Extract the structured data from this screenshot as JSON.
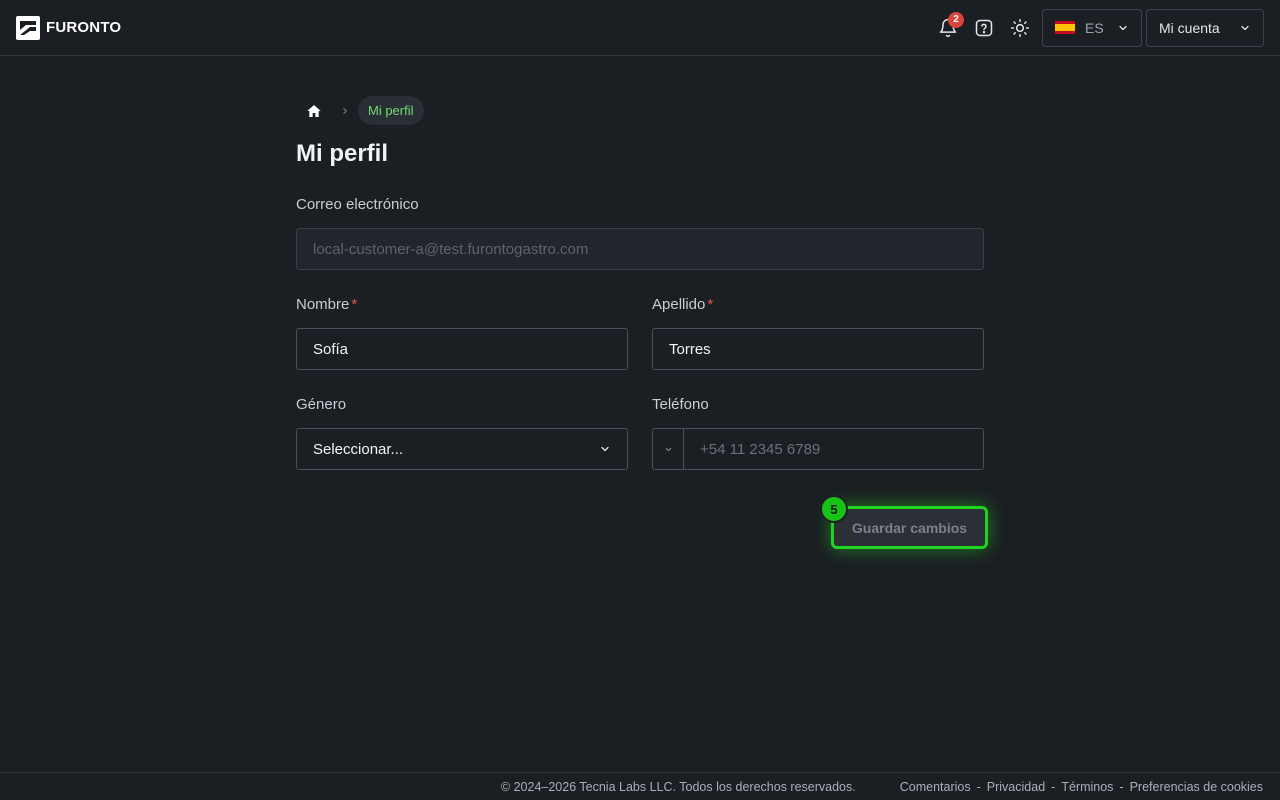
{
  "header": {
    "logo_text": "FURONTO",
    "notifications_count": "2",
    "language": {
      "code": "ES",
      "flag": "spain-flag-icon"
    },
    "account_label": "Mi cuenta"
  },
  "breadcrumb": {
    "current": "Mi perfil"
  },
  "page": {
    "title": "Mi perfil"
  },
  "form": {
    "email": {
      "label": "Correo electrónico",
      "value": "local-customer-a@test.furontogastro.com"
    },
    "first_name": {
      "label": "Nombre",
      "required_mark": "*",
      "value": "Sofía"
    },
    "last_name": {
      "label": "Apellido",
      "required_mark": "*",
      "value": "Torres"
    },
    "gender": {
      "label": "Género",
      "selected": "Seleccionar..."
    },
    "phone": {
      "label": "Teléfono",
      "placeholder": "+54 11 2345 6789"
    },
    "save_label": "Guardar cambios",
    "step_badge": "5"
  },
  "footer": {
    "copyright": "© 2024–2026 Tecnia Labs LLC. Todos los derechos reservados.",
    "links": [
      "Comentarios",
      "Privacidad",
      "Términos",
      "Preferencias de cookies"
    ],
    "separator": "-"
  },
  "colors": {
    "background": "#1b1e23",
    "accent": "#21d321",
    "breadcrumb_active": "#6fdc6f",
    "badge": "#d9453d",
    "required": "#e05a55"
  }
}
